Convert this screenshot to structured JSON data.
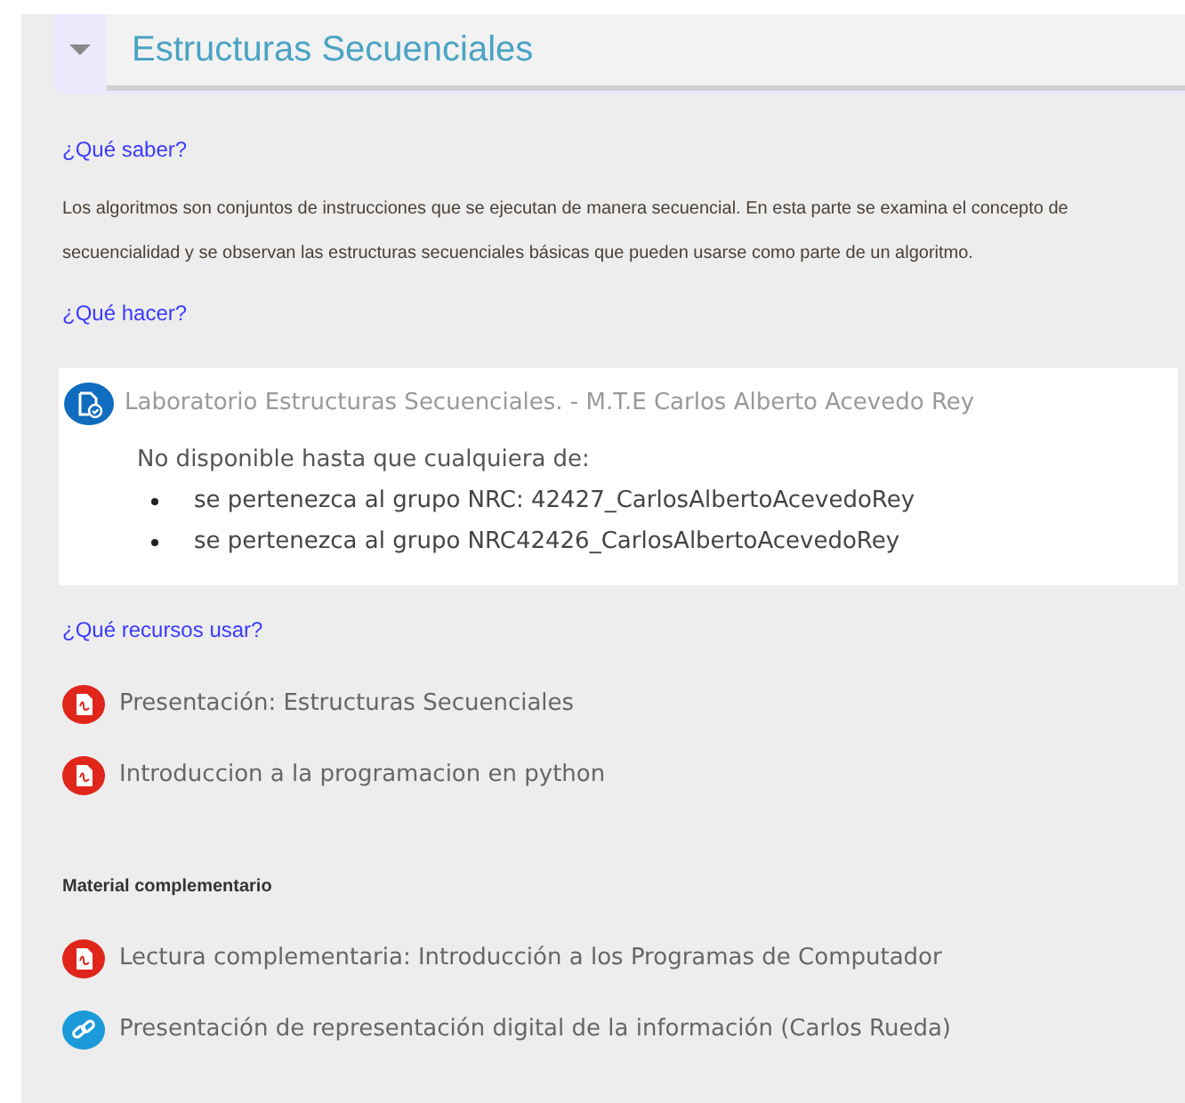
{
  "section": {
    "title": "Estructuras Secuenciales",
    "expanded": true
  },
  "know": {
    "heading": "¿Qué saber?",
    "text": "Los algoritmos son conjuntos de instrucciones que se ejecutan de manera secuencial. En esta parte se examina el concepto de secuencialidad y se observan las estructuras secuenciales básicas que pueden usarse como parte de un algoritmo."
  },
  "do": {
    "heading": "¿Qué hacer?",
    "activity": {
      "kind": "assignment",
      "title": "Laboratorio Estructuras Secuenciales. - M.T.E Carlos Alberto Acevedo Rey",
      "restriction": "No disponible hasta que cualquiera de:",
      "conditions": [
        "se pertenezca al grupo NRC: 42427_CarlosAlbertoAcevedoRey",
        "se pertenezca al grupo NRC42426_CarlosAlbertoAcevedoRey"
      ]
    }
  },
  "resources": {
    "heading": "¿Qué recursos usar?",
    "items": [
      {
        "kind": "pdf",
        "title": "Presentación: Estructuras Secuenciales"
      },
      {
        "kind": "pdf",
        "title": "Introduccion a la programacion en python"
      }
    ]
  },
  "complementary": {
    "heading": "Material complementario",
    "items": [
      {
        "kind": "pdf",
        "title": "Lectura complementaria: Introducción a los Programas de Computador"
      },
      {
        "kind": "url",
        "title": "Presentación de representación digital de la información (Carlos Rueda)"
      }
    ]
  }
}
